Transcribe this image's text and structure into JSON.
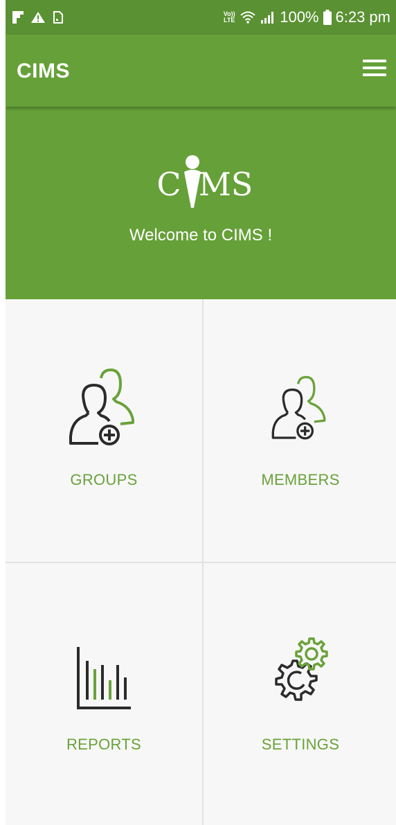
{
  "status_bar": {
    "left_icons": [
      "flipboard-icon",
      "warning-icon",
      "screenshot-icon"
    ],
    "volte_label": "Vo)) LTE",
    "battery_pct": "100%",
    "time": "6:23 pm"
  },
  "app_bar": {
    "title": "CIMS",
    "menu_icon": "hamburger-icon"
  },
  "hero": {
    "logo_text_left": "C",
    "logo_text_right": "MS",
    "welcome": "Welcome to CIMS !"
  },
  "tiles": [
    {
      "label": "GROUPS",
      "icon": "add-group-icon"
    },
    {
      "label": "MEMBERS",
      "icon": "add-member-icon"
    },
    {
      "label": "REPORTS",
      "icon": "bar-chart-icon"
    },
    {
      "label": "SETTINGS",
      "icon": "gears-icon"
    }
  ],
  "colors": {
    "status_bar": "#5a9133",
    "primary": "#66a038",
    "accent_text": "#6aa23a",
    "icon_dark": "#2b2b2b",
    "background": "#f7f7f7"
  }
}
